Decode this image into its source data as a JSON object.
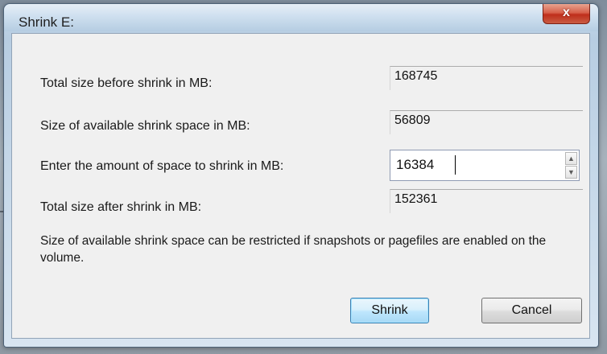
{
  "window": {
    "title": "Shrink E:",
    "close_glyph": "x"
  },
  "fields": {
    "total_before": {
      "label": "Total size before shrink in MB:",
      "value": "168745"
    },
    "available": {
      "label": "Size of available shrink space in MB:",
      "value": "56809"
    },
    "amount": {
      "label": "Enter the amount of space to shrink in MB:",
      "value": "16384"
    },
    "total_after": {
      "label": "Total size after shrink in MB:",
      "value": "152361"
    }
  },
  "note": "Size of available shrink space can be restricted if snapshots or pagefiles are enabled on the volume.",
  "buttons": {
    "shrink": "Shrink",
    "cancel": "Cancel"
  },
  "icons": {
    "close": "close-icon",
    "spin_up": "spin-up-icon",
    "spin_down": "spin-down-icon"
  },
  "colors": {
    "close_button": "#c93a24",
    "default_button_border": "#3c7fb1"
  }
}
